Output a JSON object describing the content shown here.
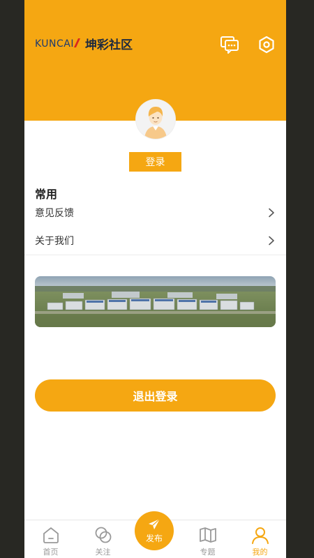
{
  "header": {
    "brand_en": "KUNCAI",
    "brand_cn": "坤彩社区",
    "icons": [
      "chat-icon",
      "gear-icon"
    ]
  },
  "profile": {
    "avatar_icon": "avatar-icon",
    "login_label": "登录"
  },
  "common": {
    "title": "常用",
    "items": [
      {
        "label": "意见反馈",
        "icon": "chevron-right-icon"
      },
      {
        "label": "关于我们",
        "icon": "chevron-right-icon"
      }
    ]
  },
  "banner": {
    "image": "factory-aerial-photo"
  },
  "logout_label": "退出登录",
  "tabbar": {
    "tabs": [
      {
        "label": "首页",
        "icon": "home-icon"
      },
      {
        "label": "关注",
        "icon": "follow-icon"
      },
      {
        "label": "发布",
        "icon": "send-icon"
      },
      {
        "label": "专题",
        "icon": "map-icon"
      },
      {
        "label": "我的",
        "icon": "user-icon"
      }
    ],
    "active": "我的"
  },
  "colors": {
    "accent": "#f5a712",
    "frame": "#282823",
    "logo_blue": "#1f3b6e",
    "logo_red": "#d8261f"
  }
}
